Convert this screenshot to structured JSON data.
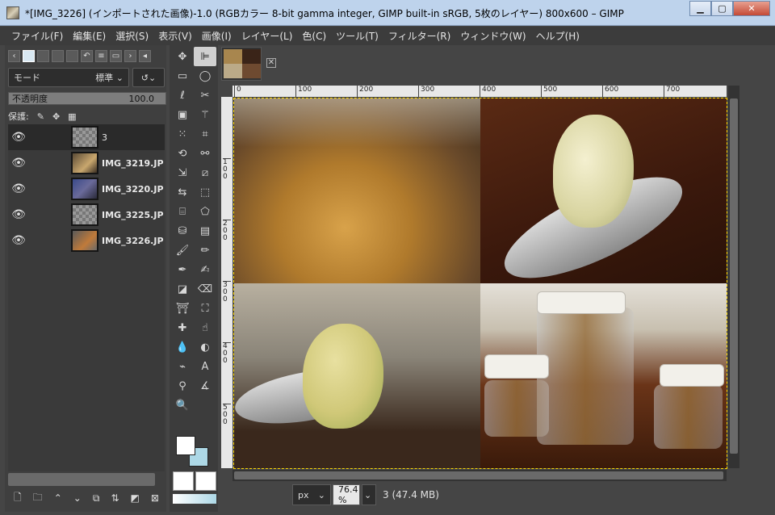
{
  "window": {
    "title": "*[IMG_3226] (インポートされた画像)-1.0 (RGBカラー 8-bit gamma integer, GIMP built-in sRGB, 5枚のレイヤー) 800x600 – GIMP",
    "minimize": "▁",
    "maximize": "▢",
    "close": "✕"
  },
  "menu": [
    "ファイル(F)",
    "編集(E)",
    "選択(S)",
    "表示(V)",
    "画像(I)",
    "レイヤー(L)",
    "色(C)",
    "ツール(T)",
    "フィルター(R)",
    "ウィンドウ(W)",
    "ヘルプ(H)"
  ],
  "layers_panel": {
    "mode_label": "モード",
    "mode_value": "標準",
    "opacity_label": "不透明度",
    "opacity_value": "100.0",
    "lock_label": "保護:",
    "layers": [
      {
        "name": "3",
        "selected": true
      },
      {
        "name": "IMG_3219.JP",
        "selected": false
      },
      {
        "name": "IMG_3220.JP",
        "selected": false
      },
      {
        "name": "IMG_3225.JP",
        "selected": false
      },
      {
        "name": "IMG_3226.JP",
        "selected": false
      }
    ]
  },
  "rulers": {
    "horizontal": [
      "0",
      "100",
      "200",
      "300",
      "400",
      "500",
      "600",
      "700"
    ],
    "vertical": [
      "100",
      "200",
      "300",
      "400",
      "500"
    ]
  },
  "status": {
    "unit": "px",
    "zoom": "76.4 %",
    "info": "3 (47.4 MB)"
  },
  "colors": {
    "foreground": "#ffffff",
    "background": "#add8e6"
  }
}
